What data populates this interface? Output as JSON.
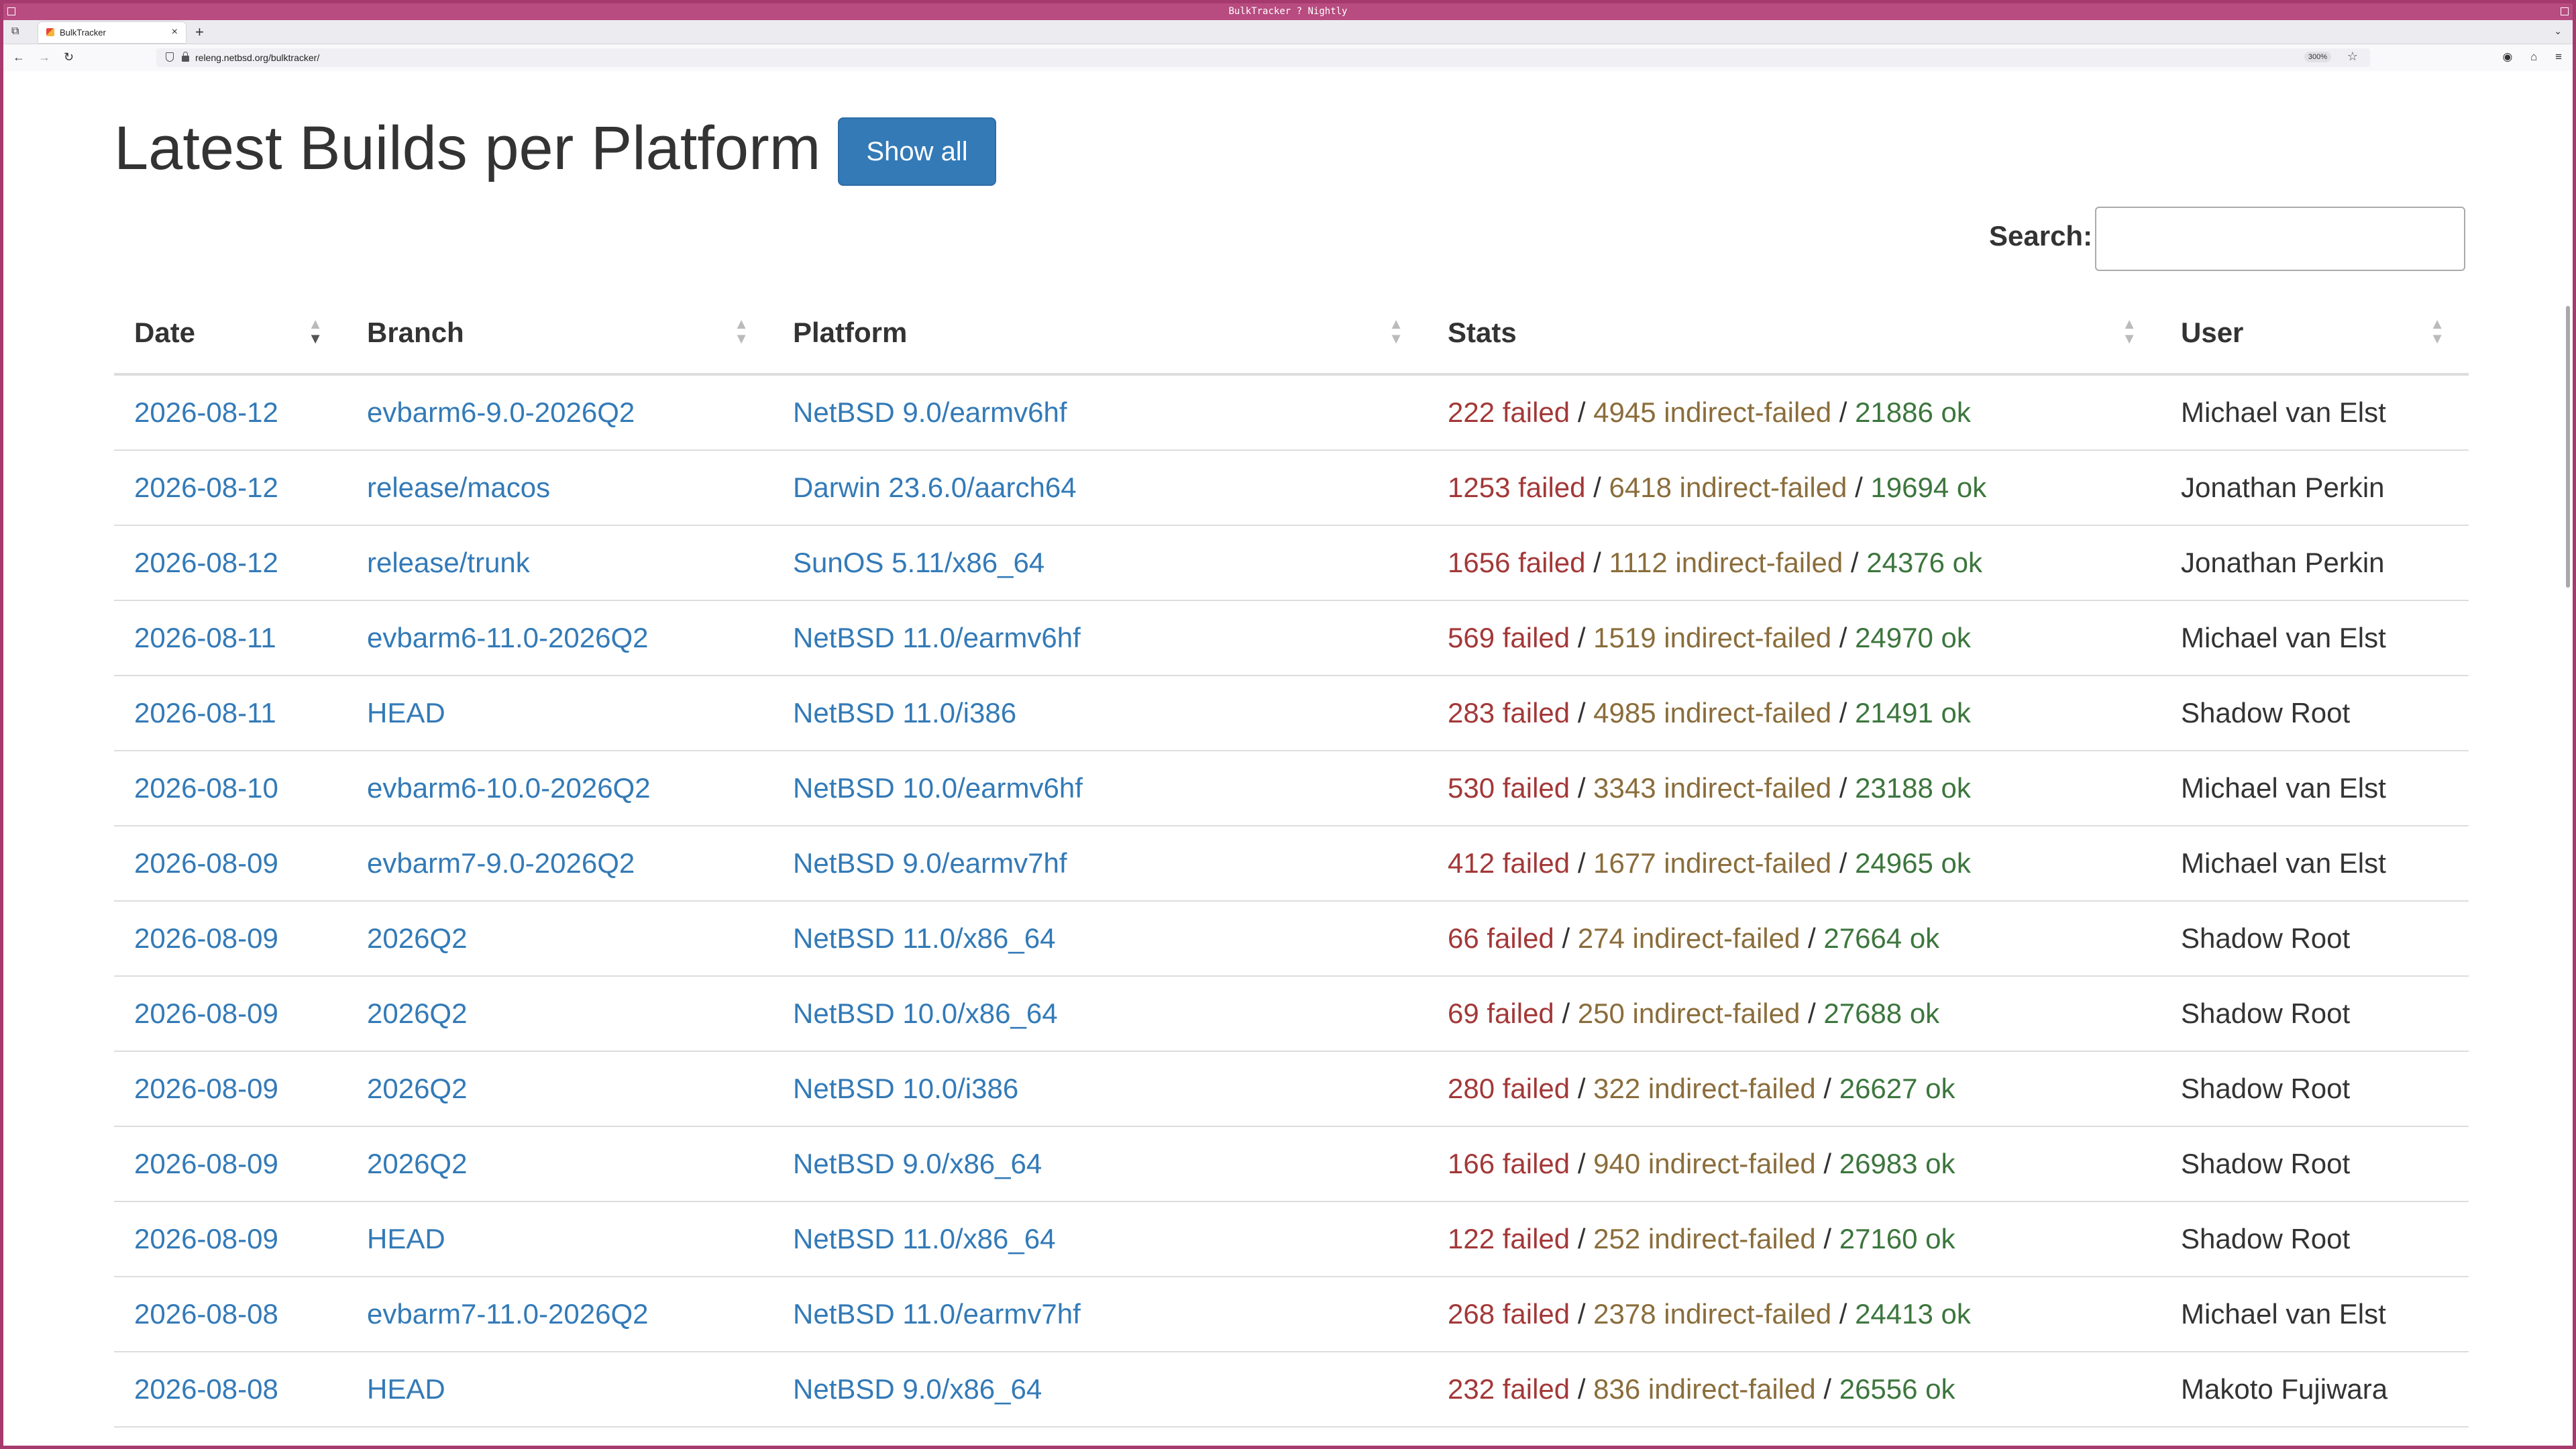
{
  "window": {
    "title": "BulkTracker ? Nightly"
  },
  "tab": {
    "title": "BulkTracker",
    "close": "×",
    "new": "+"
  },
  "toolbar": {
    "back": "←",
    "forward": "→",
    "reload": "↻",
    "url": "releng.netbsd.org/bulktracker/",
    "zoom": "300%"
  },
  "page": {
    "title": "Latest Builds per Platform",
    "show_all": "Show all",
    "search_label": "Search:",
    "search_value": ""
  },
  "table": {
    "columns": [
      "Date",
      "Branch",
      "Platform",
      "Stats",
      "User"
    ],
    "sorted_column": "Date",
    "sort_direction": "descending",
    "rows": [
      {
        "date": "2026-08-12",
        "branch": "evbarm6-9.0-2026Q2",
        "platform": "NetBSD 9.0/earmv6hf",
        "failed": "222 failed",
        "indirect": "4945 indirect-failed",
        "ok": "21886 ok",
        "user": "Michael van Elst"
      },
      {
        "date": "2026-08-12",
        "branch": "release/macos",
        "platform": "Darwin 23.6.0/aarch64",
        "failed": "1253 failed",
        "indirect": "6418 indirect-failed",
        "ok": "19694 ok",
        "user": "Jonathan Perkin"
      },
      {
        "date": "2026-08-12",
        "branch": "release/trunk",
        "platform": "SunOS 5.11/x86_64",
        "failed": "1656 failed",
        "indirect": "1112 indirect-failed",
        "ok": "24376 ok",
        "user": "Jonathan Perkin"
      },
      {
        "date": "2026-08-11",
        "branch": "evbarm6-11.0-2026Q2",
        "platform": "NetBSD 11.0/earmv6hf",
        "failed": "569 failed",
        "indirect": "1519 indirect-failed",
        "ok": "24970 ok",
        "user": "Michael van Elst"
      },
      {
        "date": "2026-08-11",
        "branch": "HEAD",
        "platform": "NetBSD 11.0/i386",
        "failed": "283 failed",
        "indirect": "4985 indirect-failed",
        "ok": "21491 ok",
        "user": "Shadow Root"
      },
      {
        "date": "2026-08-10",
        "branch": "evbarm6-10.0-2026Q2",
        "platform": "NetBSD 10.0/earmv6hf",
        "failed": "530 failed",
        "indirect": "3343 indirect-failed",
        "ok": "23188 ok",
        "user": "Michael van Elst"
      },
      {
        "date": "2026-08-09",
        "branch": "evbarm7-9.0-2026Q2",
        "platform": "NetBSD 9.0/earmv7hf",
        "failed": "412 failed",
        "indirect": "1677 indirect-failed",
        "ok": "24965 ok",
        "user": "Michael van Elst"
      },
      {
        "date": "2026-08-09",
        "branch": "2026Q2",
        "platform": "NetBSD 11.0/x86_64",
        "failed": "66 failed",
        "indirect": "274 indirect-failed",
        "ok": "27664 ok",
        "user": "Shadow Root"
      },
      {
        "date": "2026-08-09",
        "branch": "2026Q2",
        "platform": "NetBSD 10.0/x86_64",
        "failed": "69 failed",
        "indirect": "250 indirect-failed",
        "ok": "27688 ok",
        "user": "Shadow Root"
      },
      {
        "date": "2026-08-09",
        "branch": "2026Q2",
        "platform": "NetBSD 10.0/i386",
        "failed": "280 failed",
        "indirect": "322 indirect-failed",
        "ok": "26627 ok",
        "user": "Shadow Root"
      },
      {
        "date": "2026-08-09",
        "branch": "2026Q2",
        "platform": "NetBSD 9.0/x86_64",
        "failed": "166 failed",
        "indirect": "940 indirect-failed",
        "ok": "26983 ok",
        "user": "Shadow Root"
      },
      {
        "date": "2026-08-09",
        "branch": "HEAD",
        "platform": "NetBSD 11.0/x86_64",
        "failed": "122 failed",
        "indirect": "252 indirect-failed",
        "ok": "27160 ok",
        "user": "Shadow Root"
      },
      {
        "date": "2026-08-08",
        "branch": "evbarm7-11.0-2026Q2",
        "platform": "NetBSD 11.0/earmv7hf",
        "failed": "268 failed",
        "indirect": "2378 indirect-failed",
        "ok": "24413 ok",
        "user": "Michael van Elst"
      },
      {
        "date": "2026-08-08",
        "branch": "HEAD",
        "platform": "NetBSD 9.0/x86_64",
        "failed": "232 failed",
        "indirect": "836 indirect-failed",
        "ok": "26556 ok",
        "user": "Makoto Fujiwara"
      }
    ]
  },
  "colors": {
    "link": "#337ab7",
    "failed": "#a33838",
    "indirect": "#8a6d3b",
    "ok": "#3c763d",
    "button": "#337ab7"
  }
}
